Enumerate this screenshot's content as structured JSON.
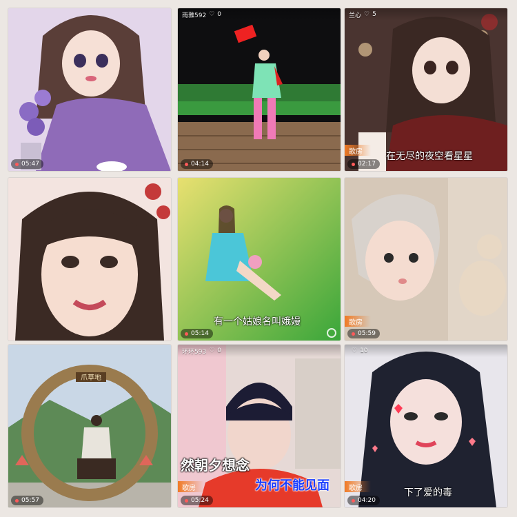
{
  "tiles": [
    {
      "username": "",
      "likes": "",
      "duration": "05:47",
      "badge": "",
      "caption": ""
    },
    {
      "username": "雨雅592",
      "likes": "0",
      "duration": "04:14",
      "badge": "",
      "caption": ""
    },
    {
      "username": "兰心",
      "likes": "5",
      "duration": "02:17",
      "badge": "歌房",
      "caption": "在无尽的夜空看星星"
    },
    {
      "username": "",
      "likes": "",
      "duration": "",
      "badge": "",
      "caption": ""
    },
    {
      "username": "",
      "likes": "",
      "duration": "05:14",
      "badge": "",
      "caption": "有一个姑娘名叫娥嫚"
    },
    {
      "username": "",
      "likes": "",
      "duration": "05:59",
      "badge": "歌房",
      "caption": ""
    },
    {
      "username": "",
      "likes": "",
      "duration": "05:57",
      "badge": "",
      "caption": "",
      "sign": "爪草地"
    },
    {
      "username": "环环593",
      "likes": "0",
      "duration": "05:24",
      "badge": "歌房",
      "caption": "然朝夕想念",
      "caption2": "为何不能见面"
    },
    {
      "username": "",
      "likes": "10",
      "duration": "04:20",
      "badge": "歌房",
      "caption": "下了爱的毒"
    }
  ],
  "icons": {
    "like": "like-icon",
    "settings": "gear-icon"
  }
}
